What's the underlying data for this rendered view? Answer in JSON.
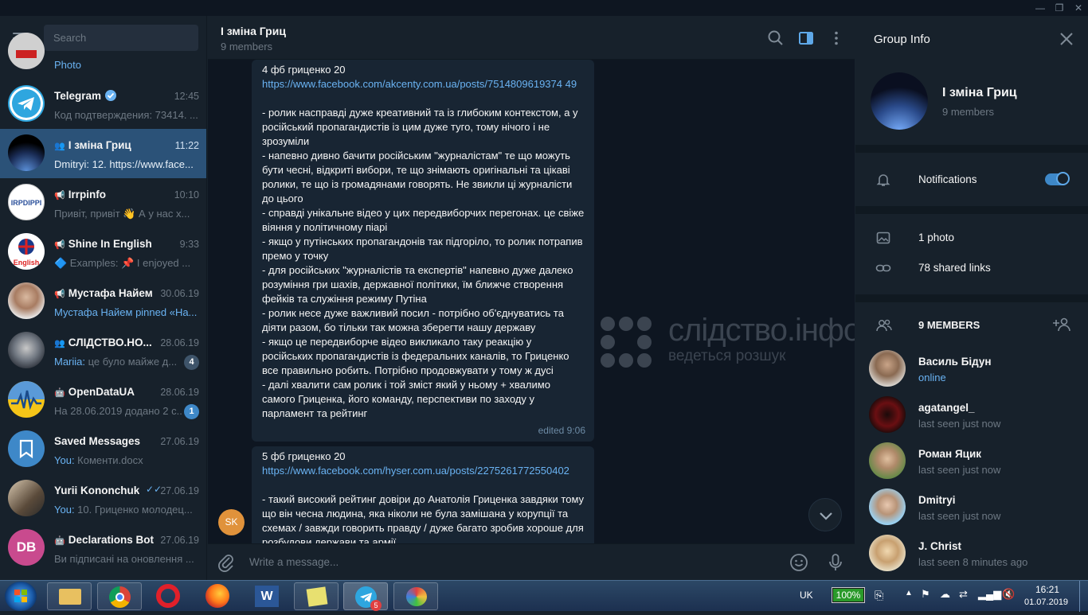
{
  "sidebar": {
    "search_placeholder": "Search",
    "top_partial": {
      "preview": "Photo"
    },
    "chats": [
      {
        "name": "Telegram",
        "time": "12:45",
        "preview": "Код подтверждения: 73414. ...",
        "verified": true,
        "icon": "telegram-logo"
      },
      {
        "name": "І зміна Гриц",
        "time": "11:22",
        "sender": "Dmitryi:",
        "preview": " 12. https://www.face...",
        "type": "group",
        "active": true
      },
      {
        "name": "Irrpinfo",
        "time": "10:10",
        "preview": "Привіт,  привіт 👋 А у нас х...",
        "type": "channel",
        "avatar_text": "IRPDIPPI"
      },
      {
        "name": "Shine In English",
        "time": "9:33",
        "preview": "🔷 Examples:  📌 I enjoyed ...",
        "type": "channel"
      },
      {
        "name": "Мустафа Найем",
        "time": "30.06.19",
        "sender": "Мустафа Найем pinned «На...",
        "preview": "",
        "type": "channel"
      },
      {
        "name": "СЛІДСТВО.НО...",
        "time": "28.06.19",
        "sender": "Mariia:",
        "preview": " це було майже д...",
        "type": "group",
        "badge": "4"
      },
      {
        "name": "OpenDataUA",
        "time": "28.06.19",
        "preview": "На 28.06.2019 додано 2 с...",
        "type": "bot",
        "badge": "1"
      },
      {
        "name": "Saved Messages",
        "time": "27.06.19",
        "sender": "You:",
        "preview": " Коменти.docx",
        "type": "saved"
      },
      {
        "name": "Yurii Kononchuk",
        "time": "27.06.19",
        "sender": "You:",
        "preview": " 10. Гриценко молодец...",
        "read": true
      },
      {
        "name": "Declarations Bot",
        "time": "27.06.19",
        "preview": "Ви підписані на оновлення ...",
        "type": "bot",
        "avatar_text": "DB"
      }
    ]
  },
  "chat": {
    "title": "І зміна Гриц",
    "subtitle": "9 members",
    "messages": [
      {
        "header": "4 фб гриценко 20",
        "link": "https://www.facebook.com/akcenty.com.ua/posts/7514809619374 49",
        "lines": [
          "",
          "- ролик насправді дуже креативний та із глибоким контекстом, а у російський пропагандистів із цим дуже туго, тому нічого і не зрозуміли",
          "- напевно дивно бачити російським \"журналістам\" те що можуть бути чесні, відкриті вибори, те що знімають оригінальні та цікаві ролики, те що із громадянами говорять. Не звикли ці журналісти до цього",
          "- справді унікальне відео у цих передвиборчих перегонах. це свіже віяння у політичному піарі",
          "- якщо у путінських пропагандонів так підгоріло, то ролик потрапив премо у точку",
          "- для російських \"журналістів та експертів\" напевно дуже далеко розуміння гри шахів, державної політики, їм ближче створення фейків та служіння режиму Путіна",
          "- ролик несе дуже важливий посил - потрібно об'єднуватись та діяти разом, бо тільки так можна зберегти нашу державу",
          "- якщо це передвиборче відео викликало таку реакцію у російських пропагандистів із федеральних каналів, то Гриценко все правильно робить. Потрібно продовжувати у тому ж дусі",
          "- далі хвалити сам ролик і той зміст який у ньому + хвалимо самого Гриценка, його команду, перспективи по заходу у парламент та рейтинг"
        ],
        "meta": "edited 9:06"
      },
      {
        "header": "5 фб гриценко 20",
        "link": "https://www.facebook.com/hyser.com.ua/posts/2275261772550402",
        "lines": [
          "",
          "- такий високий рейтинг довіри до Анатолія Гриценка завдяки тому що він чесна людина, яка ніколи не була замішана у корупції та схемах / завжди говорить правду / дуже багато зробив хороше для розбудови держави та армії"
        ]
      }
    ],
    "sender_avatar": "SK",
    "input_placeholder": "Write a message...",
    "watermark": {
      "title": "слідство.інфо",
      "subtitle": "ведеться розшук"
    }
  },
  "info": {
    "header": "Group Info",
    "group_name": "І зміна Гриц",
    "group_members": "9 members",
    "notifications_label": "Notifications",
    "notifications_on": true,
    "photos": "1 photo",
    "links": "78 shared links",
    "members_header": "9 MEMBERS",
    "members": [
      {
        "name": "Василь Бідун",
        "status": "online",
        "online": true
      },
      {
        "name": "agatangel_",
        "status": "last seen just now"
      },
      {
        "name": "Роман Яцик",
        "status": "last seen just now"
      },
      {
        "name": "Dmitryi",
        "status": "last seen just now"
      },
      {
        "name": "J. Christ",
        "status": "last seen 8 minutes ago"
      }
    ]
  },
  "taskbar": {
    "lang": "UK",
    "battery": "100%",
    "time": "16:21",
    "date": "01.07.2019",
    "telegram_badge": "5"
  },
  "colors": {
    "accent": "#6ab3f3",
    "active_chat": "#2b5278",
    "bg": "#17212b",
    "chat_bg": "#0e1621",
    "bubble": "#182533"
  }
}
